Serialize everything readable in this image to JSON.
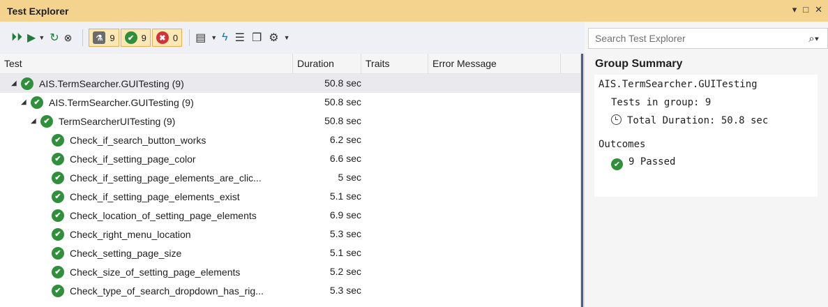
{
  "window": {
    "title": "Test Explorer",
    "controls": [
      "▾",
      "□",
      "✕"
    ]
  },
  "toolbar": {
    "run_all_icon": "run-all-icon",
    "run_icon": "run-icon",
    "repeat_icon": "repeat-last-run-icon",
    "cancel_icon": "cancel-icon",
    "filter_total_count": "9",
    "filter_passed_count": "9",
    "filter_failed_count": "0",
    "playlist_icon": "playlist-icon",
    "live_unit_icon": "live-test-icon",
    "group_icon": "group-by-icon",
    "view_icon": "view-icon",
    "settings_icon": "gear-icon"
  },
  "search": {
    "placeholder": "Search Test Explorer",
    "value": ""
  },
  "grid": {
    "columns": [
      "Test",
      "Duration",
      "Traits",
      "Error Message"
    ],
    "rows": [
      {
        "name": "AIS.TermSearcher.GUITesting (9)",
        "duration": "50.8 sec",
        "level": 0,
        "expanded": true
      },
      {
        "name": "AIS.TermSearcher.GUITesting (9)",
        "duration": "50.8 sec",
        "level": 1,
        "expanded": true
      },
      {
        "name": "TermSearcherUITesting (9)",
        "duration": "50.8 sec",
        "level": 2,
        "expanded": true
      },
      {
        "name": "Check_if_search_button_works",
        "duration": "6.2 sec",
        "level": 3
      },
      {
        "name": "Check_if_setting_page_color",
        "duration": "6.6 sec",
        "level": 3
      },
      {
        "name": "Check_if_setting_page_elements_are_clic...",
        "duration": "5 sec",
        "level": 3
      },
      {
        "name": "Check_if_setting_page_elements_exist",
        "duration": "5.1 sec",
        "level": 3
      },
      {
        "name": "Check_location_of_setting_page_elements",
        "duration": "6.9 sec",
        "level": 3
      },
      {
        "name": "Check_right_menu_location",
        "duration": "5.3 sec",
        "level": 3
      },
      {
        "name": "Check_setting_page_size",
        "duration": "5.1 sec",
        "level": 3
      },
      {
        "name": "Check_size_of_setting_page_elements",
        "duration": "5.2 sec",
        "level": 3
      },
      {
        "name": "Check_type_of_search_dropdown_has_rig...",
        "duration": "5.3 sec",
        "level": 3
      }
    ]
  },
  "summary": {
    "heading": "Group Summary",
    "group_name": "AIS.TermSearcher.GUITesting",
    "tests_in_group": "Tests in group: 9",
    "total_duration": "Total Duration: 50.8 sec",
    "outcomes_label": "Outcomes",
    "passed": "9 Passed"
  },
  "colors": {
    "titlebar": "#f3d38e",
    "pass": "#2f8f3a",
    "fail": "#d13438",
    "filter_active_bg": "#fbe8b5",
    "splitter": "#4a5d8f"
  }
}
